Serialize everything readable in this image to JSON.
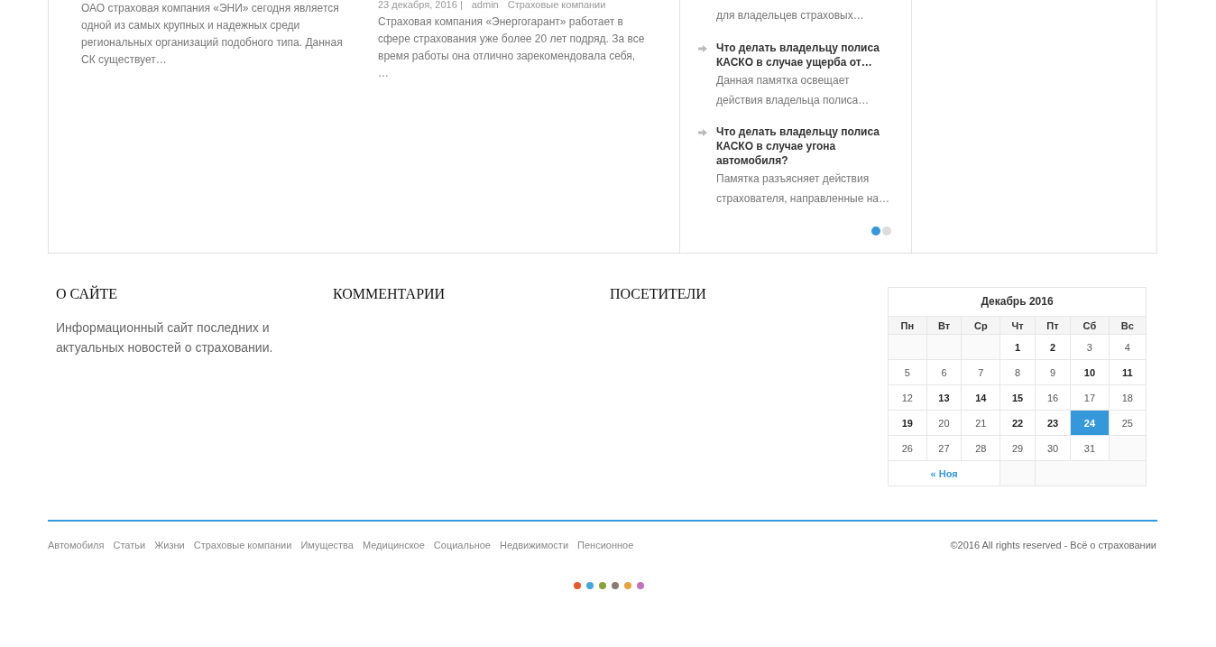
{
  "articles": [
    {
      "excerpt": "ОАО страховая компания «ЭНИ» сегодня является одной из самых крупных и надежных среди региональных организаций подобного типа. Данная СК существует…"
    },
    {
      "meta": {
        "date": "23 декабря, 2016 |",
        "author": "admin",
        "category": "Страховые компании"
      },
      "excerpt": "Страховая компания «Энергогарант» работает в сфере страхования уже более 20 лет подряд. За все время работы она отлично зарекомендовала себя, …"
    }
  ],
  "memos": [
    {
      "excerpt": "для владельцев страховых…"
    },
    {
      "title": "Что делать владельцу полиса КАСКО в случае ущерба от…",
      "excerpt": "Данная памятка освещает действия владельца полиса…"
    },
    {
      "title": "Что делать владельцу полиса КАСКО в случае угона автомобиля?",
      "excerpt": "Памятка разъясняет действия страхователя, направленные на…"
    }
  ],
  "slider_dots": [
    {
      "selected": true
    },
    {
      "selected": false
    }
  ],
  "widgets": [
    {
      "title": "О САЙТЕ",
      "text": "Информационный сайт последних и актуальных новостей о страховании."
    },
    {
      "title": "КОММЕНТАРИИ"
    },
    {
      "title": "ПОСЕТИТЕЛИ"
    }
  ],
  "calendar": {
    "title": "Декабрь 2016",
    "weekdays": [
      "Пн",
      "Вт",
      "Ср",
      "Чт",
      "Пт",
      "Сб",
      "Вс"
    ],
    "weeks": [
      [
        {
          "day": "1",
          "linked": true,
          "today": false
        },
        {
          "day": "2",
          "linked": true,
          "today": false
        },
        {
          "day": "3",
          "linked": false,
          "today": false
        },
        {
          "day": "4",
          "linked": false,
          "today": false
        }
      ],
      [
        {
          "day": "5",
          "linked": false,
          "today": false
        },
        {
          "day": "6",
          "linked": false,
          "today": false
        },
        {
          "day": "7",
          "linked": false,
          "today": false
        },
        {
          "day": "8",
          "linked": false,
          "today": false
        },
        {
          "day": "9",
          "linked": false,
          "today": false
        },
        {
          "day": "10",
          "linked": true,
          "today": false
        },
        {
          "day": "11",
          "linked": true,
          "today": false
        }
      ],
      [
        {
          "day": "12",
          "linked": false,
          "today": false
        },
        {
          "day": "13",
          "linked": true,
          "today": false
        },
        {
          "day": "14",
          "linked": true,
          "today": false
        },
        {
          "day": "15",
          "linked": true,
          "today": false
        },
        {
          "day": "16",
          "linked": false,
          "today": false
        },
        {
          "day": "17",
          "linked": false,
          "today": false
        },
        {
          "day": "18",
          "linked": false,
          "today": false
        }
      ],
      [
        {
          "day": "19",
          "linked": true,
          "today": false
        },
        {
          "day": "20",
          "linked": false,
          "today": false
        },
        {
          "day": "21",
          "linked": false,
          "today": false
        },
        {
          "day": "22",
          "linked": true,
          "today": false
        },
        {
          "day": "23",
          "linked": true,
          "today": false
        },
        {
          "day": "24",
          "linked": true,
          "today": true
        },
        {
          "day": "25",
          "linked": false,
          "today": false
        }
      ],
      [
        {
          "day": "26",
          "linked": false,
          "today": false
        },
        {
          "day": "27",
          "linked": false,
          "today": false
        },
        {
          "day": "28",
          "linked": false,
          "today": false
        },
        {
          "day": "29",
          "linked": false,
          "today": false
        },
        {
          "day": "30",
          "linked": false,
          "today": false
        },
        {
          "day": "31",
          "linked": false,
          "today": false
        }
      ]
    ],
    "prev": "« Ноя"
  },
  "footer": {
    "links": [
      "Автомобиля",
      "Статьи",
      "Жизни",
      "Страховые компании",
      "Имущества",
      "Медицинское",
      "Социальное",
      "Недвижимости",
      "Пенсионное"
    ],
    "copyright": "©2016 All rights reserved - Всё о страховании"
  },
  "color_dots": [
    {
      "color": "#e8572a"
    },
    {
      "color": "#3fa9e0"
    },
    {
      "color": "#8aa23a"
    },
    {
      "color": "#8c7b70"
    },
    {
      "color": "#e8a33d"
    },
    {
      "color": "#c173c0"
    }
  ]
}
